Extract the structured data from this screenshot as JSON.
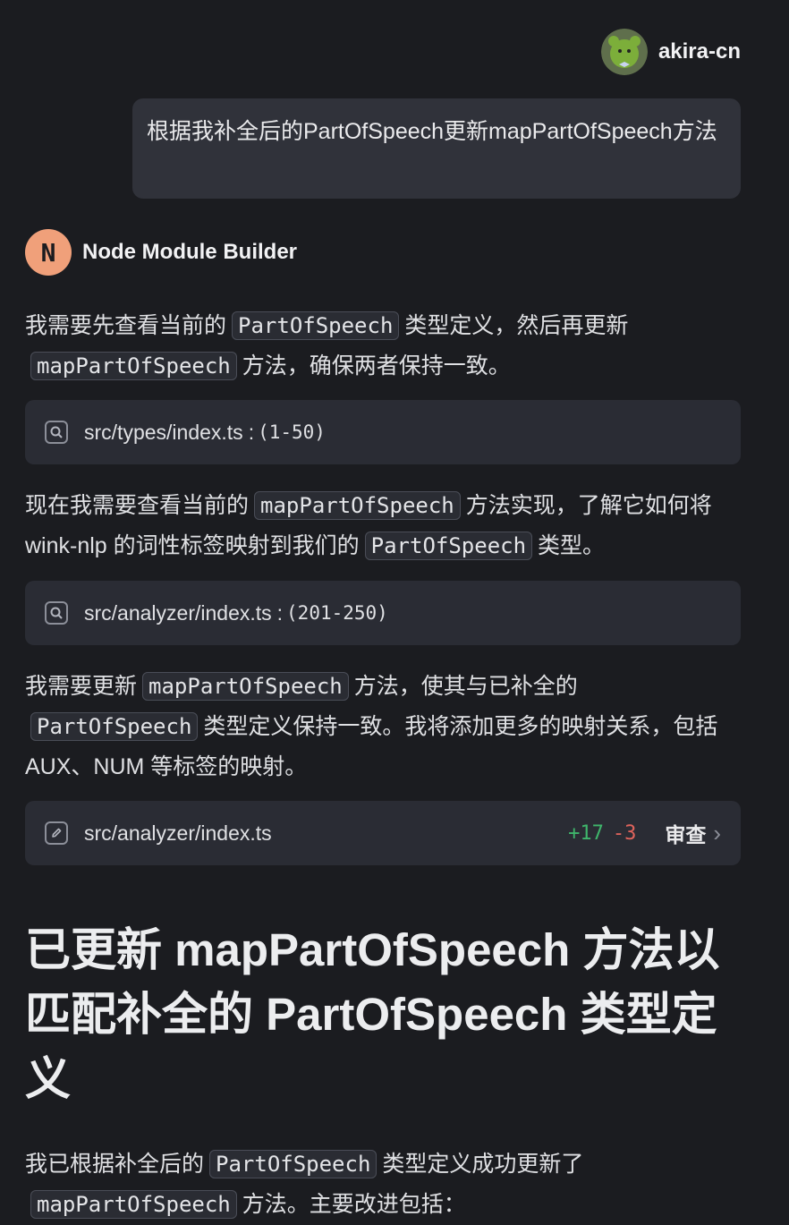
{
  "user": {
    "name": "akira-cn",
    "message": "根据我补全后的PartOfSpeech更新mapPartOfSpeech方法"
  },
  "assistant": {
    "initial": "N",
    "name": "Node Module Builder"
  },
  "para1": {
    "t1": "我需要先查看当前的",
    "c1": "PartOfSpeech",
    "t2": "类型定义，然后再更新",
    "c2": "mapPartOfSpeech",
    "t3": "方法，确保两者保持一致。"
  },
  "tool1": {
    "icon": "search-icon",
    "path": "src/types/index.ts",
    "sep": ":",
    "range": "(1-50)"
  },
  "para2": {
    "t1": "现在我需要查看当前的",
    "c1": "mapPartOfSpeech",
    "t2": "方法实现，了解它如何将 wink-nlp 的词性标签映射到我们的",
    "c2": "PartOfSpeech",
    "t3": "类型。"
  },
  "tool2": {
    "icon": "search-icon",
    "path": "src/analyzer/index.ts",
    "sep": ":",
    "range": "(201-250)"
  },
  "para3": {
    "t1": "我需要更新",
    "c1": "mapPartOfSpeech",
    "t2": "方法，使其与已补全的",
    "c2": "PartOfSpeech",
    "t3": "类型定义保持一致。我将添加更多的映射关系，包括 AUX、NUM 等标签的映射。"
  },
  "tool3": {
    "icon": "edit-icon",
    "path": "src/analyzer/index.ts",
    "added": "+17",
    "removed": "-3",
    "review": "审查"
  },
  "heading": "已更新 mapPartOfSpeech 方法以匹配补全的 PartOfSpeech 类型定义",
  "para4": {
    "t1": "我已根据补全后的",
    "c1": "PartOfSpeech",
    "t2": "类型定义成功更新了",
    "c2": "mapPartOfSpeech",
    "t3": "方法。主要改进包括："
  }
}
